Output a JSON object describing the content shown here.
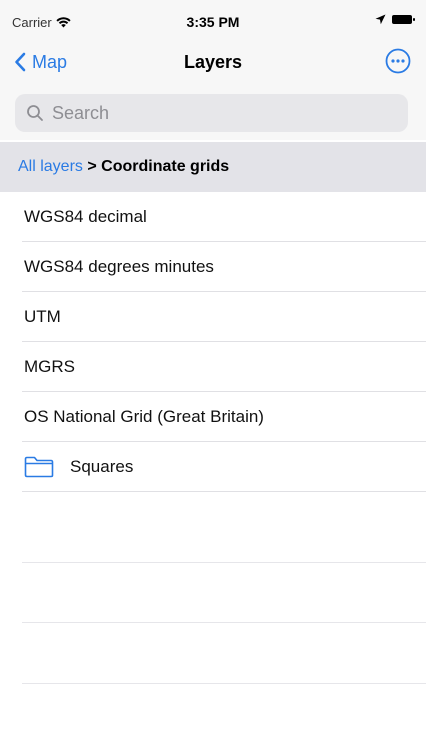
{
  "status_bar": {
    "carrier": "Carrier",
    "time": "3:35 PM"
  },
  "nav": {
    "back_label": "Map",
    "title": "Layers"
  },
  "search": {
    "placeholder": "Search",
    "value": ""
  },
  "breadcrumb": {
    "root": "All layers",
    "separator": ">",
    "current": "Coordinate grids"
  },
  "layers": [
    {
      "label": "WGS84 decimal",
      "icon": null
    },
    {
      "label": "WGS84 degrees minutes",
      "icon": null
    },
    {
      "label": "UTM",
      "icon": null
    },
    {
      "label": "MGRS",
      "icon": null
    },
    {
      "label": "OS National Grid (Great Britain)",
      "icon": null
    },
    {
      "label": "Squares",
      "icon": "folder-icon"
    }
  ],
  "colors": {
    "accent": "#2a7be4",
    "breadcrumb_bg": "#e3e3e8",
    "bar_bg": "#f7f7f7"
  }
}
